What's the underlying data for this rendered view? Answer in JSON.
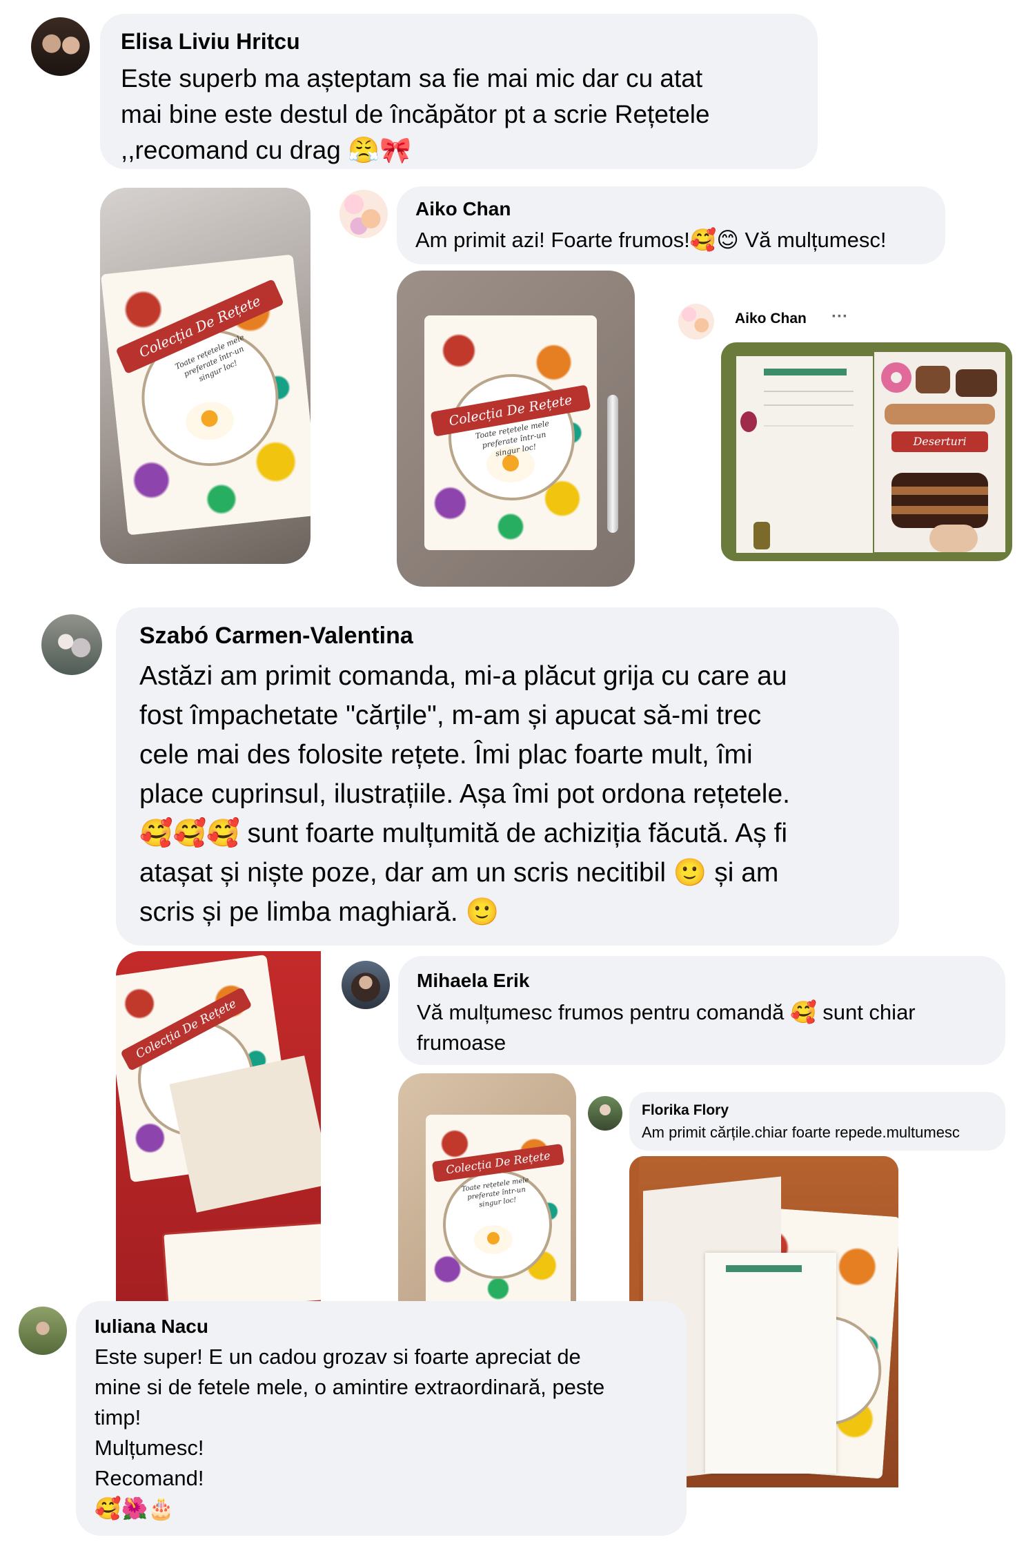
{
  "comments": [
    {
      "id": "elisa",
      "name": "Elisa Liviu Hritcu",
      "text": "Este superb ma așteptam sa fie mai mic dar cu atat\nmai bine este destul de încăpător pt a scrie Rețetele\n,,recomand cu drag 😤🎀"
    },
    {
      "id": "aiko",
      "name": "Aiko Chan",
      "text": "Am primit azi! Foarte frumos!🥰😊 Vă mulțumesc!",
      "post_name": "Aiko Chan",
      "more_icon": "···",
      "open_book_title": "Deserturi"
    },
    {
      "id": "szabo",
      "name": "Szabó Carmen-Valentina",
      "text": "Astăzi am primit comanda, mi-a plăcut grija cu care au\nfost împachetate \"cărțile\", m-am și apucat să-mi trec\ncele mai des folosite rețete. Îmi plac foarte mult, îmi\nplace cuprinsul, ilustrațiile. Așa îmi pot ordona rețetele.\n🥰🥰🥰 sunt foarte mulțumită de achiziția făcută. Aș fi\natașat și niște poze, dar am un scris necitibil 🙂 și am\nscris și pe limba maghiară. 🙂"
    },
    {
      "id": "mihaela",
      "name": "Mihaela Erik",
      "text": "Vă mulțumesc frumos pentru comandă 🥰 sunt chiar\nfrumoase"
    },
    {
      "id": "florika",
      "name": "Florika Flory",
      "text": "Am primit cărțile.chiar foarte repede.multumesc"
    },
    {
      "id": "iuliana",
      "name": "Iuliana Nacu",
      "text": "Este super! E un cadou grozav si foarte apreciat de\nmine si de fetele mele, o amintire extraordinară, peste\ntimp!\nMulțumesc!\nRecomand!\n🥰🌺🎂"
    }
  ],
  "book": {
    "title": "Colecția De Rețete",
    "subtitle": "Toate rețetele mele\npreferate într-un\nsingur loc!"
  },
  "colors": {
    "bubble": "#f0f2f5",
    "text": "#050505",
    "ribbon": "#b8322e"
  }
}
